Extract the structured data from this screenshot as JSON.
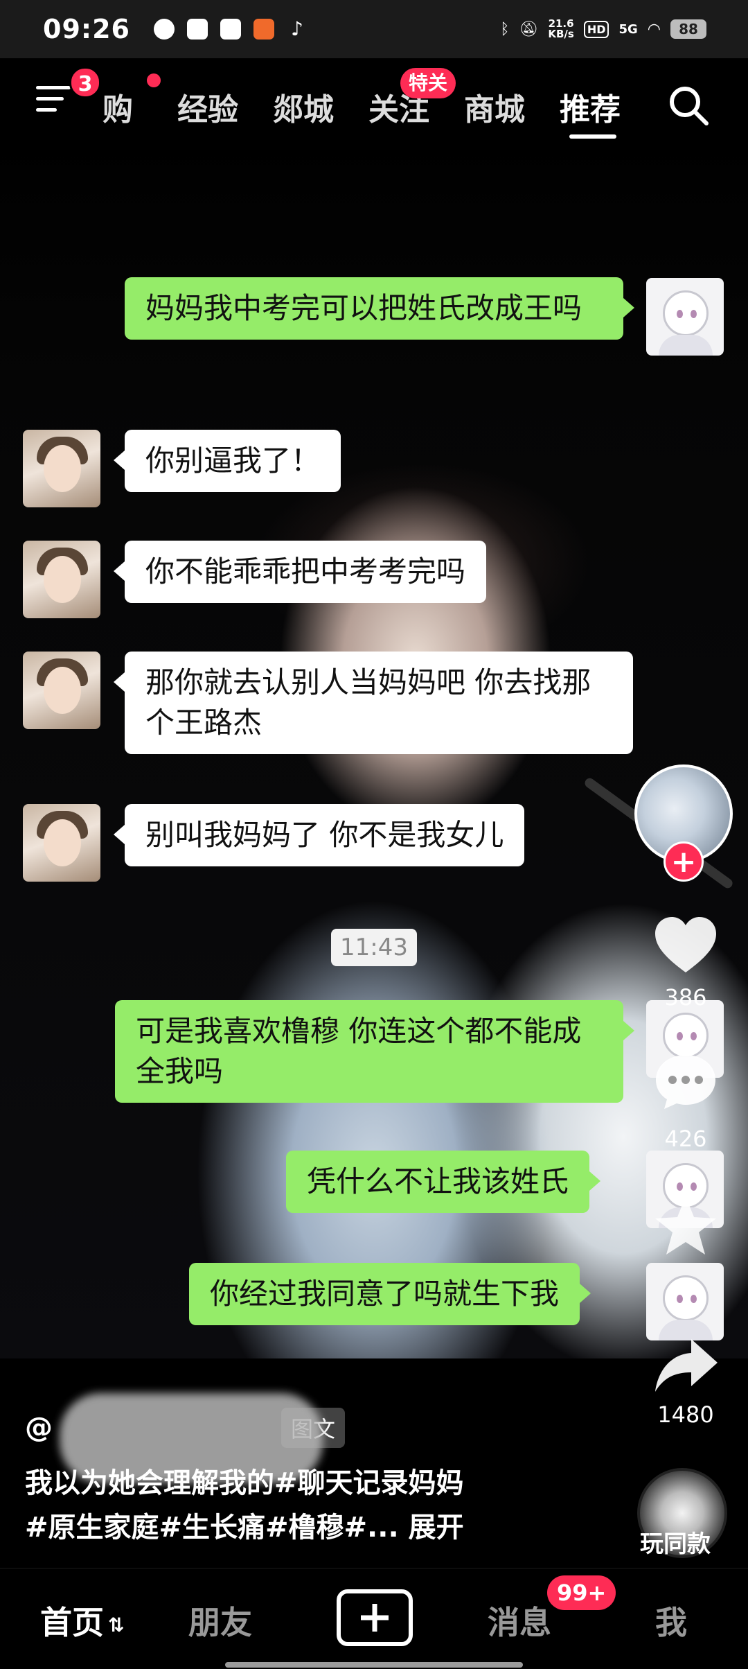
{
  "status_bar": {
    "time": "09:26",
    "net_speed_value": "21.6",
    "net_speed_unit": "KB/s",
    "hd": "HD",
    "signal": "5G",
    "battery": "88"
  },
  "top_nav": {
    "menu_badge": "3",
    "tabs": [
      "购",
      "经验",
      "郯城",
      "关注",
      "商城",
      "推荐"
    ],
    "active_tab": "推荐",
    "follow_badge": "特关"
  },
  "chat": {
    "messages": [
      {
        "side": "me",
        "text": "妈妈我中考完可以把姓氏改成王吗"
      },
      {
        "side": "mom",
        "text": "你别逼我了！"
      },
      {
        "side": "mom",
        "text": "你不能乖乖把中考考完吗"
      },
      {
        "side": "mom",
        "text": "那你就去认别人当妈妈吧 你去找那个王路杰"
      },
      {
        "side": "mom",
        "text": "别叫我妈妈了 你不是我女儿"
      },
      {
        "side": "me",
        "text": "可是我喜欢橹穆 你连这个都不能成全我吗"
      },
      {
        "side": "me",
        "text": "凭什么不让我该姓氏"
      },
      {
        "side": "me",
        "text": "你经过我同意了吗就生下我"
      }
    ],
    "timestamp": "11:43"
  },
  "right_rail": {
    "likes": "386",
    "comments": "426",
    "shares": "1480",
    "follow_symbol": "+"
  },
  "caption": {
    "author_prefix": "@",
    "content_tag": "图文",
    "line1": "我以为她会理解我的#聊天记录妈妈",
    "line2": "#原生家庭#生长痛#橹穆#...",
    "expand": "展开"
  },
  "bgm": {
    "label": "玩同款"
  },
  "bottom_nav": {
    "home": "首页",
    "friends": "朋友",
    "messages": "消息",
    "messages_badge": "99+",
    "me": "我"
  },
  "colors": {
    "accent": "#fe2c55",
    "chat_green": "#95ec69",
    "chat_white": "#ffffff"
  }
}
